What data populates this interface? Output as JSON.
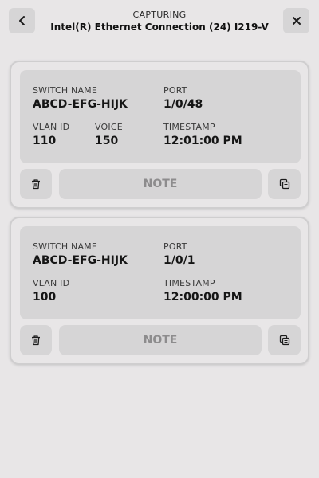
{
  "header": {
    "status": "CAPTURING",
    "interface": "Intel(R) Ethernet Connection (24) I219-V",
    "back_icon": "chevron-left-icon",
    "close_icon": "close-icon"
  },
  "captures": [
    {
      "switch_name_label": "SWITCH NAME",
      "switch_name": "ABCD-EFG-HIJK",
      "port_label": "PORT",
      "port": "1/0/48",
      "vlan_label": "VLAN ID",
      "vlan": "110",
      "voice_label": "VOICE",
      "voice": "150",
      "timestamp_label": "TIMESTAMP",
      "timestamp": "12:01:00 PM",
      "note_label": "NOTE"
    },
    {
      "switch_name_label": "SWITCH NAME",
      "switch_name": "ABCD-EFG-HIJK",
      "port_label": "PORT",
      "port": "1/0/1",
      "vlan_label": "VLAN ID",
      "vlan": "100",
      "timestamp_label": "TIMESTAMP",
      "timestamp": "12:00:00 PM",
      "note_label": "NOTE"
    }
  ],
  "icons": {
    "delete": "trash-icon",
    "copy": "copy-icon"
  }
}
